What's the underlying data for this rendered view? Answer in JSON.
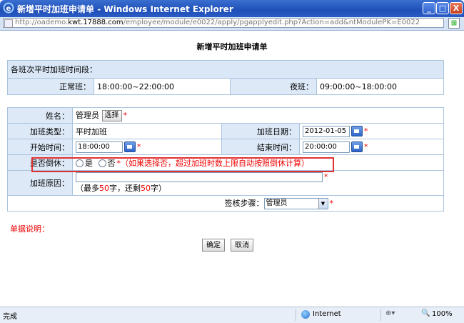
{
  "window": {
    "title_bold": "新增平时加班申请单",
    "title_rest": " - Windows Internet Explorer",
    "minimize": "_",
    "maximize": "□",
    "close": "X"
  },
  "address": {
    "prefix": "http://oademo.",
    "host": "kwt.17888.com",
    "path": "/employee/module/e0022/apply/pgapplyedit.php?Action=add&ntModulePK=E0022"
  },
  "page": {
    "title": "新增平时加班申请单"
  },
  "shifts": {
    "header": "各班次平时加班时间段：",
    "normal_label": "正常班：",
    "normal_value": "18:00:00~22:00:00",
    "night_label": "夜班：",
    "night_value": "09:00:00~18:00:00"
  },
  "form": {
    "name_label": "姓名：",
    "name_value": "管理员",
    "select_btn": "选择",
    "type_label": "加班类型：",
    "type_value": "平时加班",
    "date_label": "加班日期：",
    "date_value": "2012-01-05",
    "start_label": "开始时间：",
    "start_value": "18:00:00",
    "end_label": "结束时间：",
    "end_value": "20:00:00",
    "comp_label": "是否倒休：",
    "comp_yes": "是",
    "comp_no": "否",
    "comp_note": "（如果选择否，超过加班时数上限自动按照倒休计算）",
    "reason_label": "加班原因：",
    "reason_hint_a": "（最多",
    "reason_hint_max": "50",
    "reason_hint_b": "字，还剩",
    "reason_hint_left": "50",
    "reason_hint_c": "字）",
    "approve_label": "签核步骤：",
    "approve_value": "管理员",
    "required_mark": "*"
  },
  "note_label": "单据说明：",
  "buttons": {
    "ok": "确定",
    "cancel": "取消"
  },
  "status": {
    "text": "完成",
    "zone": "Internet",
    "zoom": "100%"
  }
}
